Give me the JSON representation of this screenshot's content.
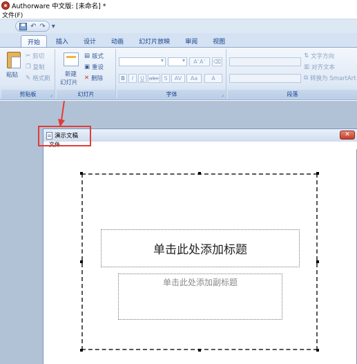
{
  "app": {
    "title": "Authorware 中文版: [未命名] *",
    "menu_file": "文件(F)"
  },
  "qat": {
    "undo": "↶",
    "redo": "↷",
    "more": "▾"
  },
  "tabs": [
    "开始",
    "插入",
    "设计",
    "动画",
    "幻灯片放映",
    "审阅",
    "视图"
  ],
  "ribbon": {
    "clipboard": {
      "paste": "粘贴",
      "cut": "剪切",
      "copy": "复制",
      "format_painter": "格式刷",
      "label": "剪贴板"
    },
    "slides": {
      "new_slide": "新建",
      "new_slide2": "幻灯片",
      "layout": "版式",
      "reset": "重设",
      "delete": "删除",
      "label": "幻灯片"
    },
    "font": {
      "label": "字体",
      "bold": "B",
      "italic": "I",
      "underline": "U",
      "strike": "abc",
      "shadow": "S",
      "spacing": "AV",
      "case": "Aa",
      "color": "A",
      "grow": "A",
      "shrink": "A"
    },
    "paragraph": {
      "text_direction": "文字方向",
      "align_text": "对齐文本",
      "smartart": "转换为 SmartArt",
      "label": "段落"
    }
  },
  "doc_window": {
    "title": "演示文稿",
    "menu_file": "文件",
    "close": "✕"
  },
  "slide": {
    "title_placeholder": "单击此处添加标题",
    "subtitle_placeholder": "单击此处添加副标题"
  }
}
